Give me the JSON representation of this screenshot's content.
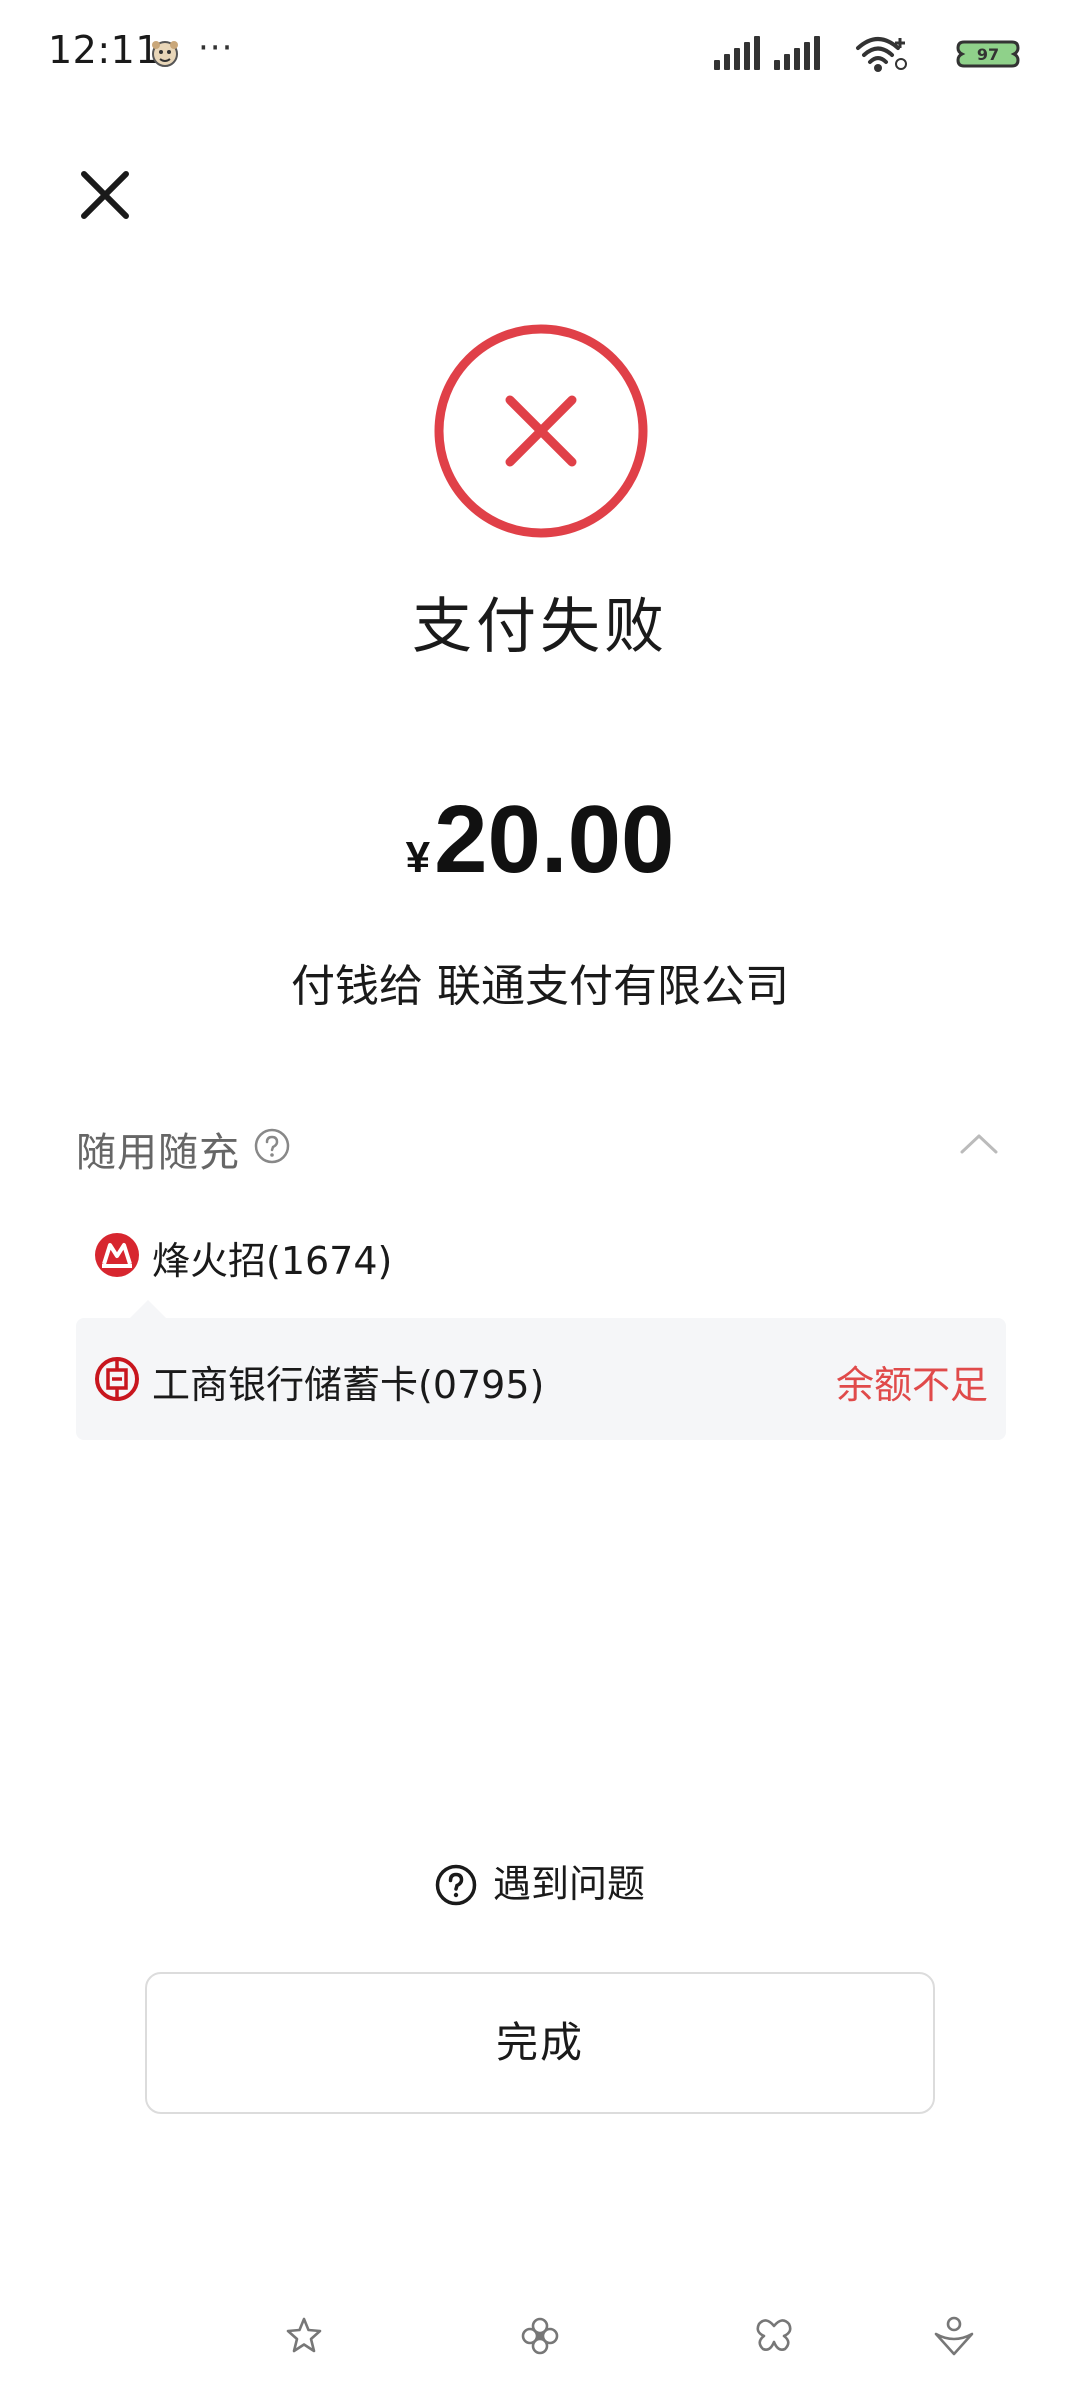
{
  "status_bar": {
    "time": "12:11",
    "more": "···",
    "battery_level": "97",
    "icons": [
      "app-mascot-icon",
      "signal-icon",
      "signal-icon",
      "wifi-icon",
      "battery-icon"
    ]
  },
  "header": {
    "close_icon": "close-icon"
  },
  "result": {
    "status_icon": "error-circle-icon",
    "status_color": "#e04048",
    "title": "支付失败",
    "currency_symbol": "¥",
    "amount": "20.00",
    "payee": "付钱给 联通支付有限公司"
  },
  "payment_section": {
    "title": "随用随充",
    "help_icon": "question-circle-icon",
    "collapse_icon": "chevron-up-icon",
    "methods": [
      {
        "name": "烽火招(1674)",
        "logo": "cmb-bank-logo",
        "status": ""
      },
      {
        "name": "工商银行储蓄卡(0795)",
        "logo": "icbc-bank-logo",
        "status": "余额不足"
      }
    ],
    "error_color": "#e04a4a"
  },
  "actions": {
    "problem_label": "遇到问题",
    "done_label": "完成"
  },
  "bottom_nav": {
    "icons": [
      "star-icon",
      "flower-icon",
      "butterfly-icon",
      "heart-person-icon"
    ]
  }
}
